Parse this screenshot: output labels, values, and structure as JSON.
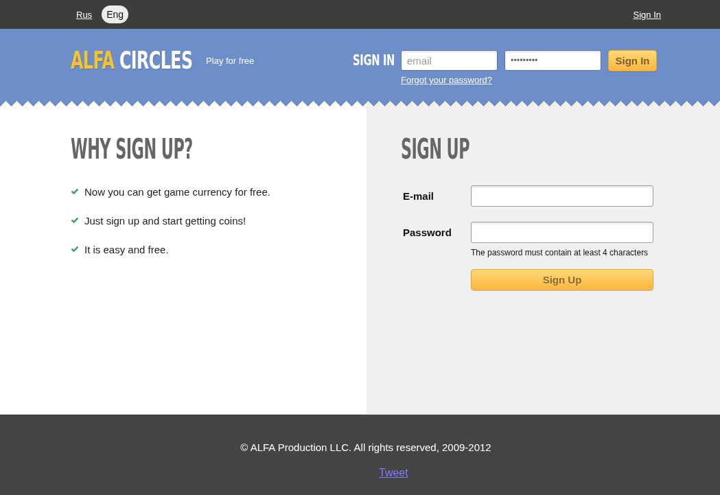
{
  "top_bar": {
    "languages": [
      {
        "label": "Rus",
        "selected": false
      },
      {
        "label": "Eng",
        "selected": true
      }
    ],
    "sign_in_link": "Sign In"
  },
  "header": {
    "logo": {
      "part_1": "ALFA",
      "part_2": "CIRCLES"
    },
    "tagline": "Play for free",
    "sign_in": {
      "title": "SIGN IN",
      "email_field": {
        "placeholder": "email"
      },
      "password_field": {
        "value": "•••••••••"
      },
      "button": "Sign In",
      "forgot_link": "Forgot your password?"
    }
  },
  "why_sign_up": {
    "title": "WHY SIGN UP?",
    "items": [
      "Now you can get game currency for free.",
      "Just sign up and start getting coins!",
      "It is easy and free."
    ]
  },
  "sign_up": {
    "title": "SIGN UP",
    "fields": [
      {
        "label": "E-mail"
      },
      {
        "label": "Password",
        "hint": "The password must contain at least 4 characters"
      }
    ],
    "button": "Sign Up"
  },
  "footer": {
    "copyright": "© ALFA Production LLC. All rights reserved, 2009-2012",
    "tweet_link": "Tweet"
  }
}
